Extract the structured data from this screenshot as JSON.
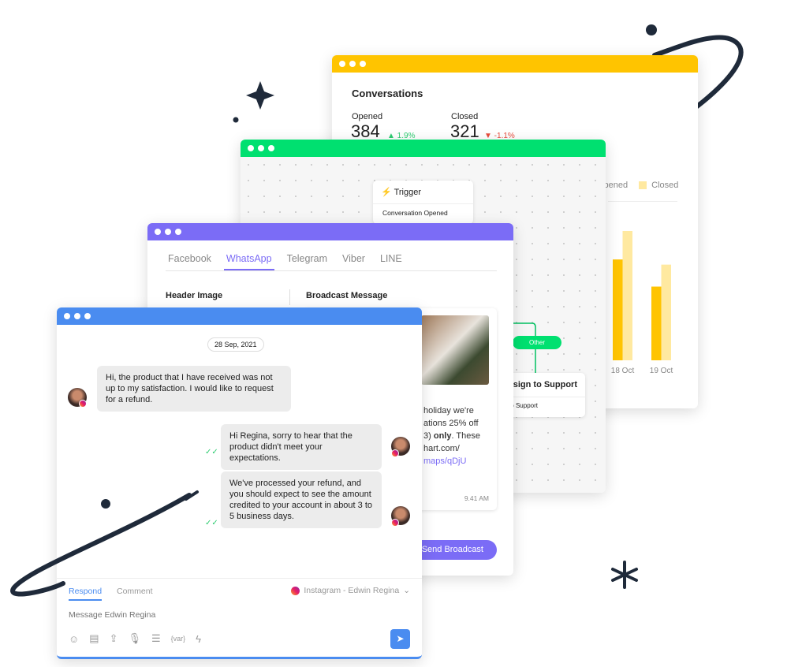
{
  "colors": {
    "yellow": "#FFC400",
    "green": "#00E070",
    "purple": "#7B6CF6",
    "blue": "#4A8CF0",
    "ink": "#1F2A3A"
  },
  "analytics": {
    "title": "Conversations",
    "opened_label": "Opened",
    "opened_value": "384",
    "opened_change": "▲ 1.9%",
    "closed_label": "Closed",
    "closed_value": "321",
    "closed_change": "▼ -1.1%",
    "legend_opened": "Opened",
    "legend_closed": "Closed"
  },
  "chart_data": {
    "type": "bar",
    "categories": [
      "18 Oct",
      "19 Oct"
    ],
    "series": [
      {
        "name": "Opened",
        "values": [
          78,
          57
        ],
        "color": "#FFC400"
      },
      {
        "name": "Closed",
        "values": [
          100,
          74
        ],
        "color": "#FFE9A0"
      }
    ],
    "legend": "top-right",
    "grid": false
  },
  "flow": {
    "trigger_title": "Trigger",
    "trigger_sub": "Conversation Opened",
    "branch": "Other",
    "assign_title": "Assign to Support",
    "assign_sub": "Assign to Support"
  },
  "broadcast": {
    "tabs": [
      "Facebook",
      "WhatsApp",
      "Telegram",
      "Viber",
      "LINE"
    ],
    "active_tab": "WhatsApp",
    "header_image_label": "Header Image",
    "message_label": "Broadcast Message",
    "message_lines": [
      "holiday we're",
      "ations 25% off",
      "3) "
    ],
    "message_bold": "only",
    "message_after": ". These",
    "message_url1": "hart.com/",
    "message_link": "maps/qDjU",
    "time": "9.41 AM",
    "send_button": "Send Broadcast"
  },
  "chat": {
    "date": "28 Sep, 2021",
    "messages": [
      {
        "from": "customer",
        "text": "Hi, the product that I have received was not up to my satisfaction. I would like to request for a refund."
      },
      {
        "from": "agent",
        "text": "Hi Regina, sorry to hear that the product didn't meet your expectations."
      },
      {
        "from": "agent",
        "text": "We've processed your refund, and you should expect to see the amount credited to your account in about 3 to 5 business days."
      }
    ],
    "tab_respond": "Respond",
    "tab_comment": "Comment",
    "channel": "Instagram - Edwin Regina",
    "placeholder": "Message Edwin Regina",
    "var_label": "{var}",
    "toolbar_icons": [
      "emoji-icon",
      "clipboard-icon",
      "upload-icon",
      "microphone-icon",
      "document-icon",
      "variable-icon",
      "lightning-icon"
    ]
  }
}
